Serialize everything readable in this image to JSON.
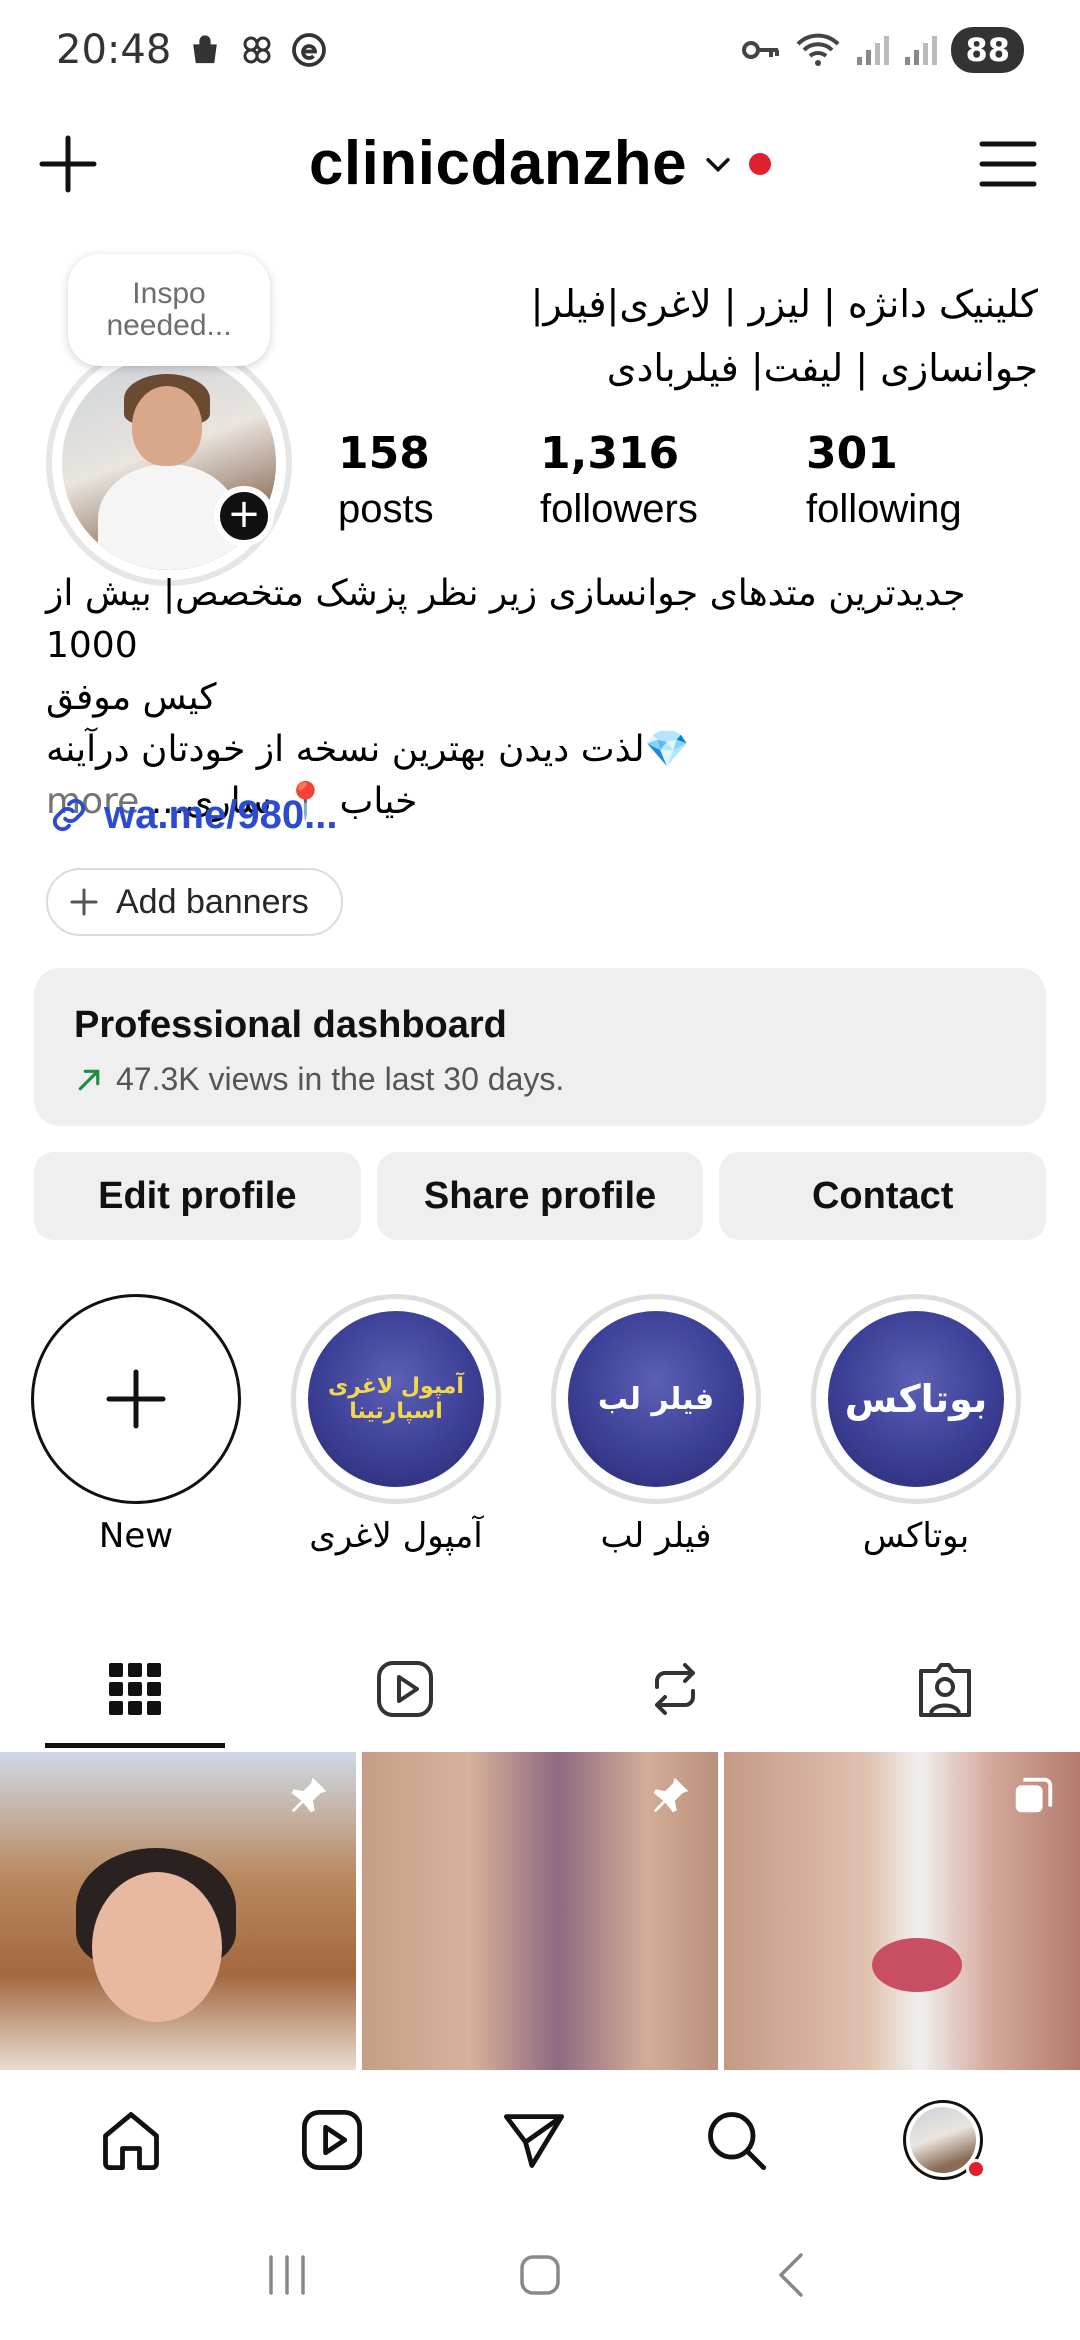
{
  "status_bar": {
    "time": "20:48",
    "battery": "88",
    "icons": [
      "bag-icon",
      "pinwheel-icon",
      "e-app-icon",
      "key-icon",
      "wifi-icon",
      "signal-icon",
      "signal-icon"
    ]
  },
  "header": {
    "username": "clinicdanzhe",
    "create_icon": "plus-icon",
    "menu_icon": "hamburger-menu-icon",
    "notification_dot_color": "#e0212b"
  },
  "profile": {
    "note": "Inspo needed...",
    "display_name": "کلینیک دانژه | لیزر | لاغری|فیلر| جوانسازی | لیفت| فیلربادی",
    "stats": [
      {
        "value": "158",
        "label": "posts"
      },
      {
        "value": "1,316",
        "label": "followers"
      },
      {
        "value": "301",
        "label": "following"
      }
    ],
    "bio_lines": [
      "جدیدترین متدهای جوانسازی زیر نظر پزشک متخصص| بیش از 1000",
      "کیس موفق",
      "💎لذت دیدن بهترین نسخه از خودتان درآینه",
      "خیاب 📍 ساری..."
    ],
    "more": "more",
    "link": "wa.me/980...",
    "add_banners": "Add banners"
  },
  "dashboard": {
    "title": "Professional dashboard",
    "subtitle": "47.3K views in the last 30 days.",
    "accent": "#1a8f3c"
  },
  "actions": {
    "edit": "Edit profile",
    "share": "Share profile",
    "contact": "Contact"
  },
  "highlights": [
    {
      "label": "New",
      "cover": ""
    },
    {
      "label": "آمپول لاغری",
      "cover": "آمپول لاغری اسپارتینا"
    },
    {
      "label": "فیلر لب",
      "cover": "فیلر لب"
    },
    {
      "label": "بوتاکس",
      "cover": "بوتاکس"
    }
  ],
  "tabs": [
    "grid-icon",
    "reels-icon",
    "reposts-icon",
    "tagged-icon"
  ],
  "nav": [
    "home-icon",
    "reels-icon",
    "send-icon",
    "search-icon",
    "profile-avatar"
  ]
}
